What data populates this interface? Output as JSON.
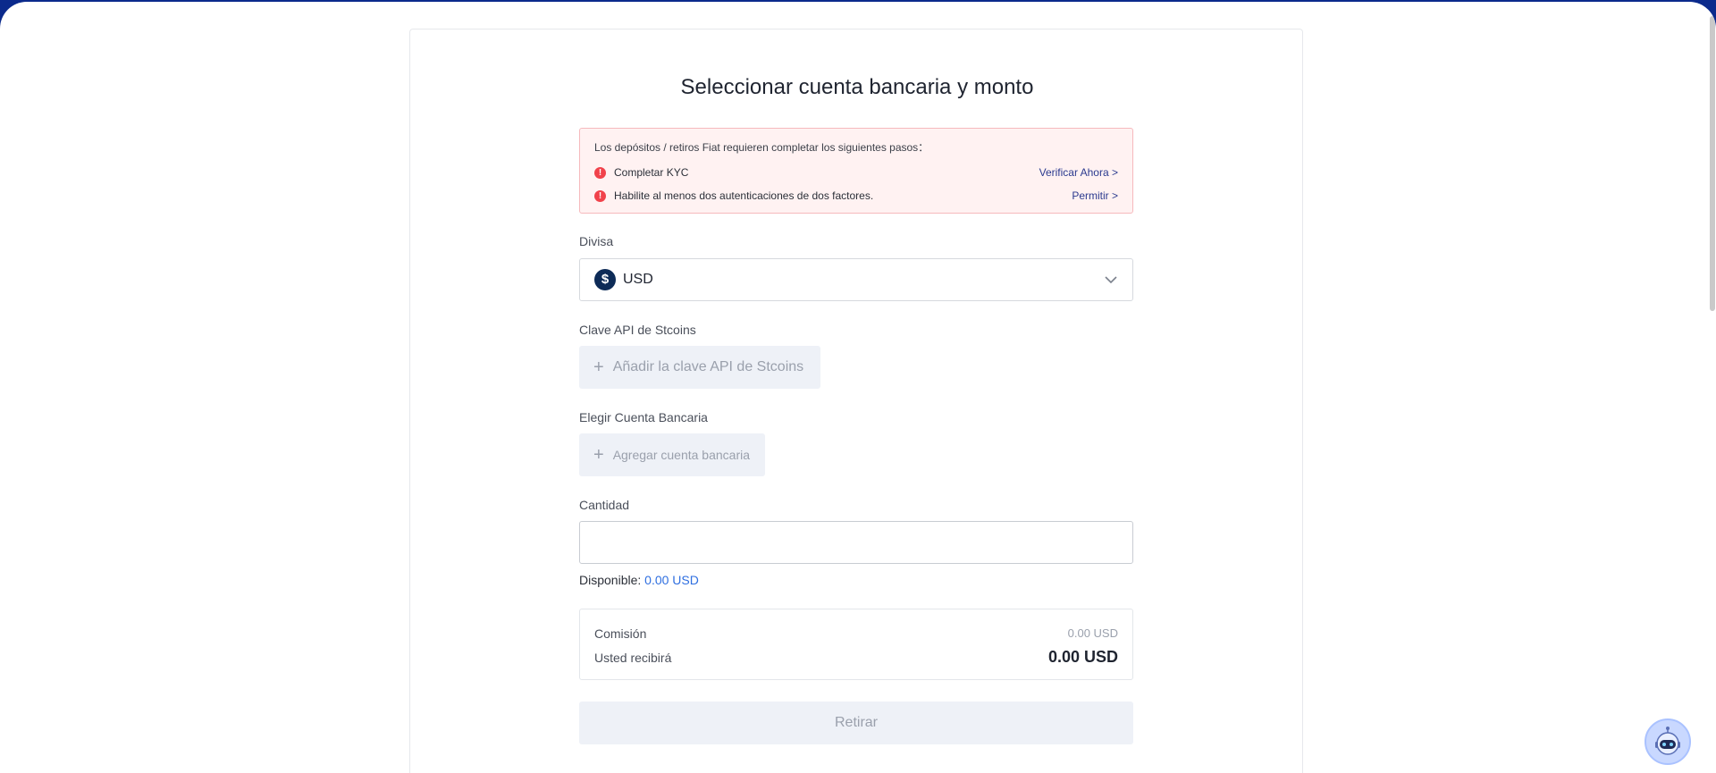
{
  "page": {
    "title": "Seleccionar cuenta bancaria y monto"
  },
  "alert": {
    "heading": "Los depósitos / retiros Fiat requieren completar los siguientes pasos：",
    "steps": [
      {
        "text": "Completar KYC",
        "link": "Verificar Ahora >"
      },
      {
        "text": "Habilite al menos dos autenticaciones de dos factores.",
        "link": "Permitir >"
      }
    ]
  },
  "currency": {
    "label": "Divisa",
    "value": "USD",
    "icon": "dollar-coin-icon"
  },
  "api_key": {
    "label": "Clave API de Stcoins",
    "button": "Añadir la clave API de Stcoins"
  },
  "bank": {
    "label": "Elegir Cuenta Bancaria",
    "button": "Agregar cuenta bancaria"
  },
  "amount": {
    "label": "Cantidad",
    "value": "",
    "available_label": "Disponible:",
    "available_value": "0.00 USD"
  },
  "summary": {
    "fee_label": "Comisión",
    "fee_value": "0.00 USD",
    "receive_label": "Usted recibirá",
    "receive_value": "0.00 USD"
  },
  "submit": {
    "label": "Retirar"
  },
  "colors": {
    "brand_bar": "#0b2a8c",
    "warning": "#f1424b",
    "link": "#2f6fe0",
    "button_disabled": "#eef1f7"
  }
}
